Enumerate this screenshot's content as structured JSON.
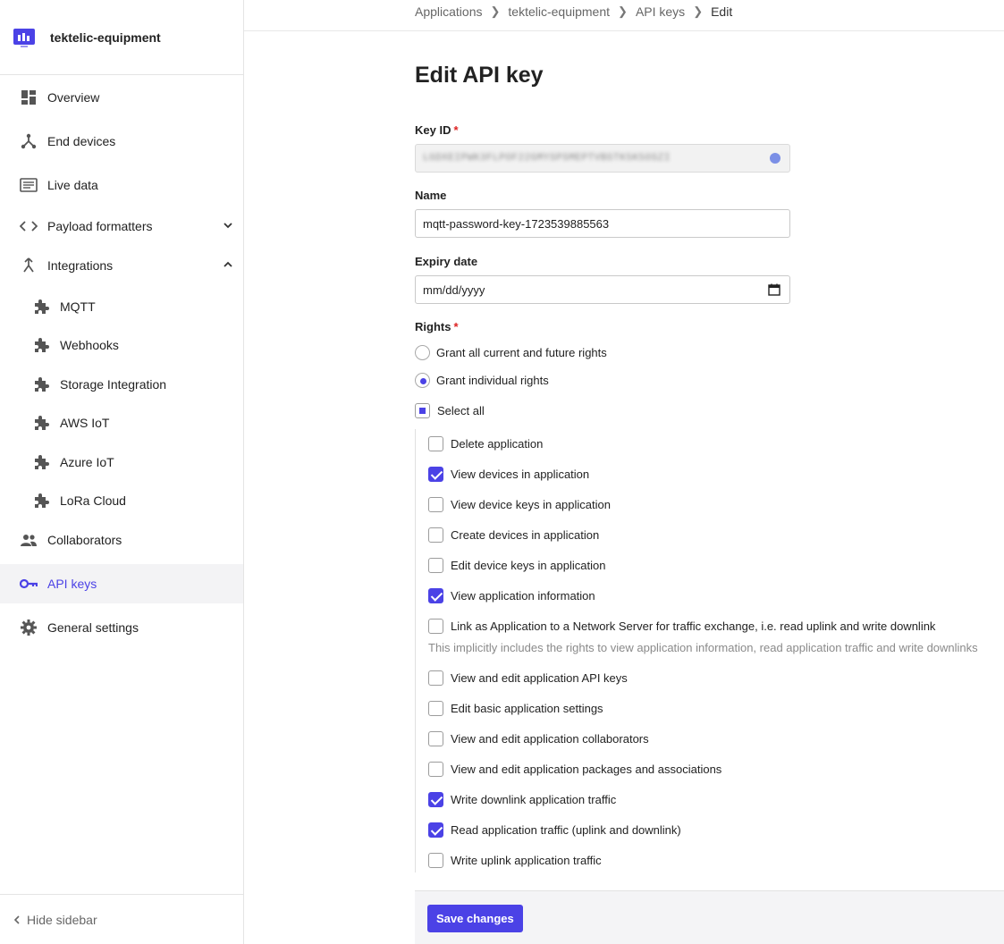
{
  "sidebar": {
    "app_name": "tektelic-equipment",
    "items": [
      {
        "label": "Overview"
      },
      {
        "label": "End devices"
      },
      {
        "label": "Live data"
      },
      {
        "label": "Payload formatters"
      },
      {
        "label": "Integrations"
      },
      {
        "label": "MQTT"
      },
      {
        "label": "Webhooks"
      },
      {
        "label": "Storage Integration"
      },
      {
        "label": "AWS IoT"
      },
      {
        "label": "Azure IoT"
      },
      {
        "label": "LoRa Cloud"
      },
      {
        "label": "Collaborators"
      },
      {
        "label": "API keys"
      },
      {
        "label": "General settings"
      }
    ],
    "hide_label": "Hide sidebar",
    "accent": "#4b42e6"
  },
  "breadcrumb": [
    "Applications",
    "tektelic-equipment",
    "API keys",
    "Edit"
  ],
  "page": {
    "title": "Edit API key",
    "key_id_label": "Key ID",
    "key_id_value": "LGDXEIPWK3FLPOF22GMYSPSMEPTVBSTK5K5OSZI",
    "name_label": "Name",
    "name_value": "mqtt-password-key-1723539885563",
    "expiry_label": "Expiry date",
    "expiry_placeholder": "mm/dd/yyyy",
    "rights_label": "Rights",
    "required_mark": "*",
    "radio_all": "Grant all current and future rights",
    "radio_individual": "Grant individual rights",
    "select_all": "Select all",
    "rights": [
      {
        "label": "Delete application",
        "checked": false
      },
      {
        "label": "View devices in application",
        "checked": true
      },
      {
        "label": "View device keys in application",
        "checked": false
      },
      {
        "label": "Create devices in application",
        "checked": false
      },
      {
        "label": "Edit device keys in application",
        "checked": false
      },
      {
        "label": "View application information",
        "checked": true
      },
      {
        "label": "Link as Application to a Network Server for traffic exchange, i.e. read uplink and write downlink",
        "checked": false
      },
      {
        "label": "View and edit application API keys",
        "checked": false
      },
      {
        "label": "Edit basic application settings",
        "checked": false
      },
      {
        "label": "View and edit application collaborators",
        "checked": false
      },
      {
        "label": "View and edit application packages and associations",
        "checked": false
      },
      {
        "label": "Write downlink application traffic",
        "checked": true
      },
      {
        "label": "Read application traffic (uplink and downlink)",
        "checked": true
      },
      {
        "label": "Write uplink application traffic",
        "checked": false
      }
    ],
    "link_hint": "This implicitly includes the rights to view application information, read application traffic and write downlinks",
    "save_label": "Save changes"
  }
}
